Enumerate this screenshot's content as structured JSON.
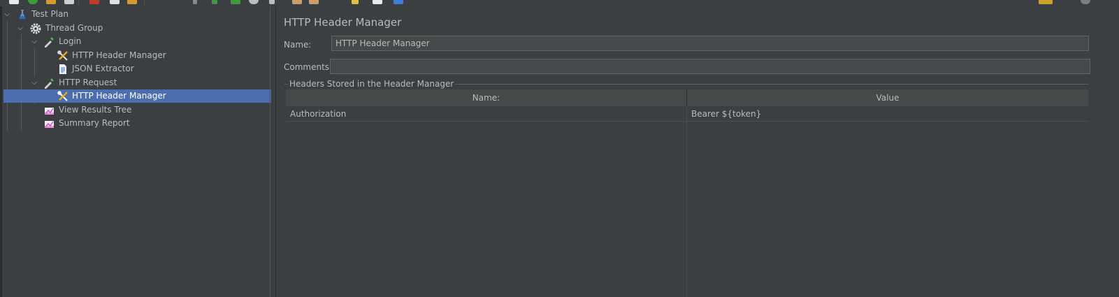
{
  "tree": {
    "items": [
      {
        "label": "Test Plan",
        "icon": "flask-icon"
      },
      {
        "label": "Thread Group",
        "icon": "gear-icon"
      },
      {
        "label": "Login",
        "icon": "pipette-icon"
      },
      {
        "label": "HTTP Header Manager",
        "icon": "tools-icon"
      },
      {
        "label": "JSON Extractor",
        "icon": "document-icon"
      },
      {
        "label": "HTTP Request",
        "icon": "pipette-icon"
      },
      {
        "label": "HTTP Header Manager",
        "icon": "tools-icon"
      },
      {
        "label": "View Results Tree",
        "icon": "chart-icon"
      },
      {
        "label": "Summary Report",
        "icon": "chart-icon"
      }
    ],
    "selected_label": "HTTP Header Manager"
  },
  "editor": {
    "title": "HTTP Header Manager",
    "name_label": "Name:",
    "name_value": "HTTP Header Manager",
    "comments_label": "Comments:",
    "comments_value": "",
    "group_title": "Headers Stored in the Header Manager",
    "table": {
      "columns": [
        "Name:",
        "Value"
      ],
      "rows": [
        [
          "Authorization",
          "Bearer ${token}"
        ]
      ]
    }
  },
  "colors": {
    "background": "#3c3f41",
    "selection": "#4b6eaf",
    "field_bg": "#45494a",
    "text": "#bbbbbb"
  }
}
